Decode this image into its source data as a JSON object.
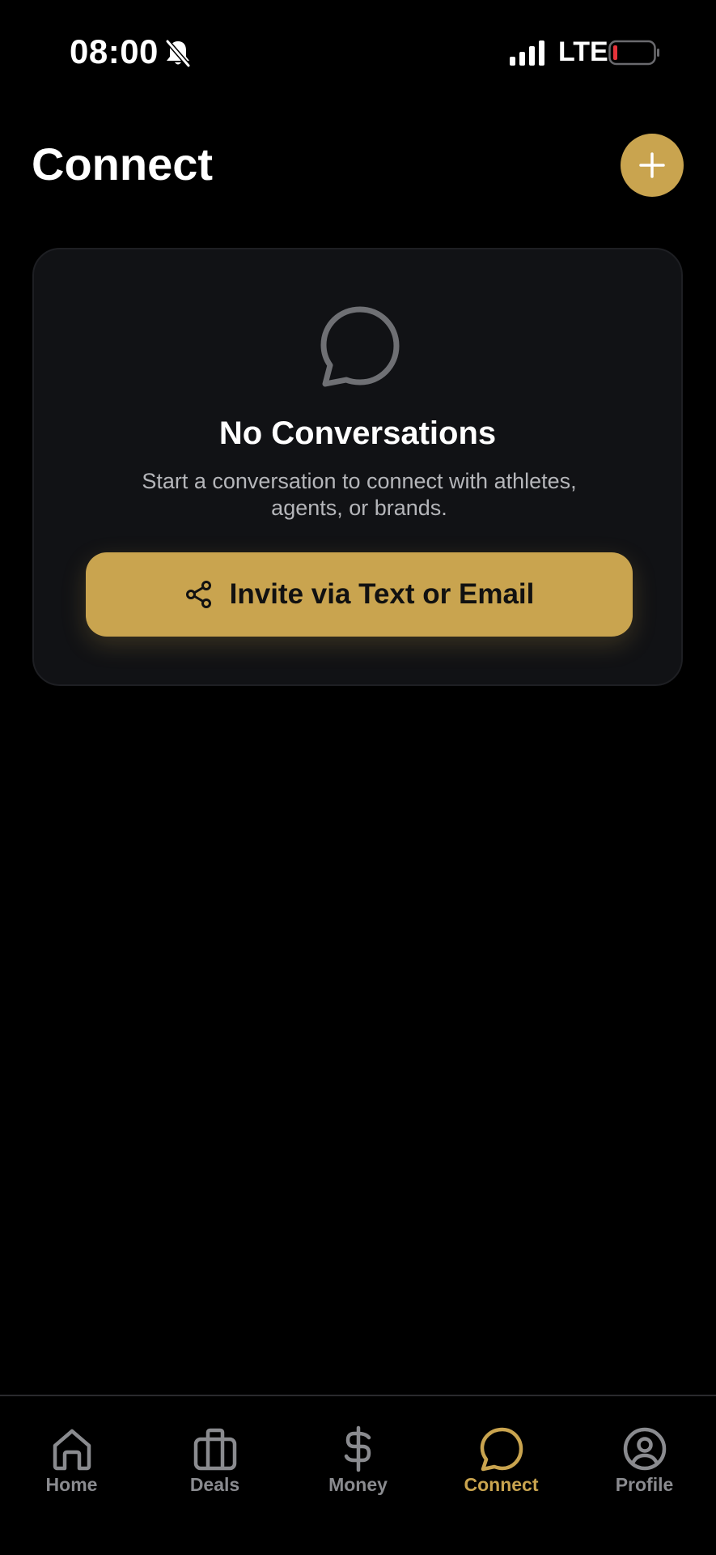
{
  "status_bar": {
    "time": "08:00",
    "network": "LTE",
    "icons": [
      "bell-slash-icon",
      "signal-icon",
      "battery-low-icon"
    ]
  },
  "header": {
    "title": "Connect",
    "add_icon": "plus-icon"
  },
  "empty_state": {
    "icon": "chat-bubble-icon",
    "title": "No Conversations",
    "description": "Start a conversation to connect with athletes, agents, or brands.",
    "button_label": "Invite via Text or Email",
    "button_icon": "share-icon"
  },
  "tab_bar": {
    "items": [
      {
        "label": "Home",
        "icon": "home-icon",
        "active": false
      },
      {
        "label": "Deals",
        "icon": "briefcase-icon",
        "active": false
      },
      {
        "label": "Money",
        "icon": "dollar-icon",
        "active": false
      },
      {
        "label": "Connect",
        "icon": "chat-bubble-icon",
        "active": true
      },
      {
        "label": "Profile",
        "icon": "user-circle-icon",
        "active": false
      }
    ]
  },
  "colors": {
    "background": "#000000",
    "accent": "#c9a44f",
    "card": "#111215",
    "muted_text": "#b5b6ba",
    "inactive_tab": "#8a8b8f",
    "battery_low": "#e5333a"
  }
}
